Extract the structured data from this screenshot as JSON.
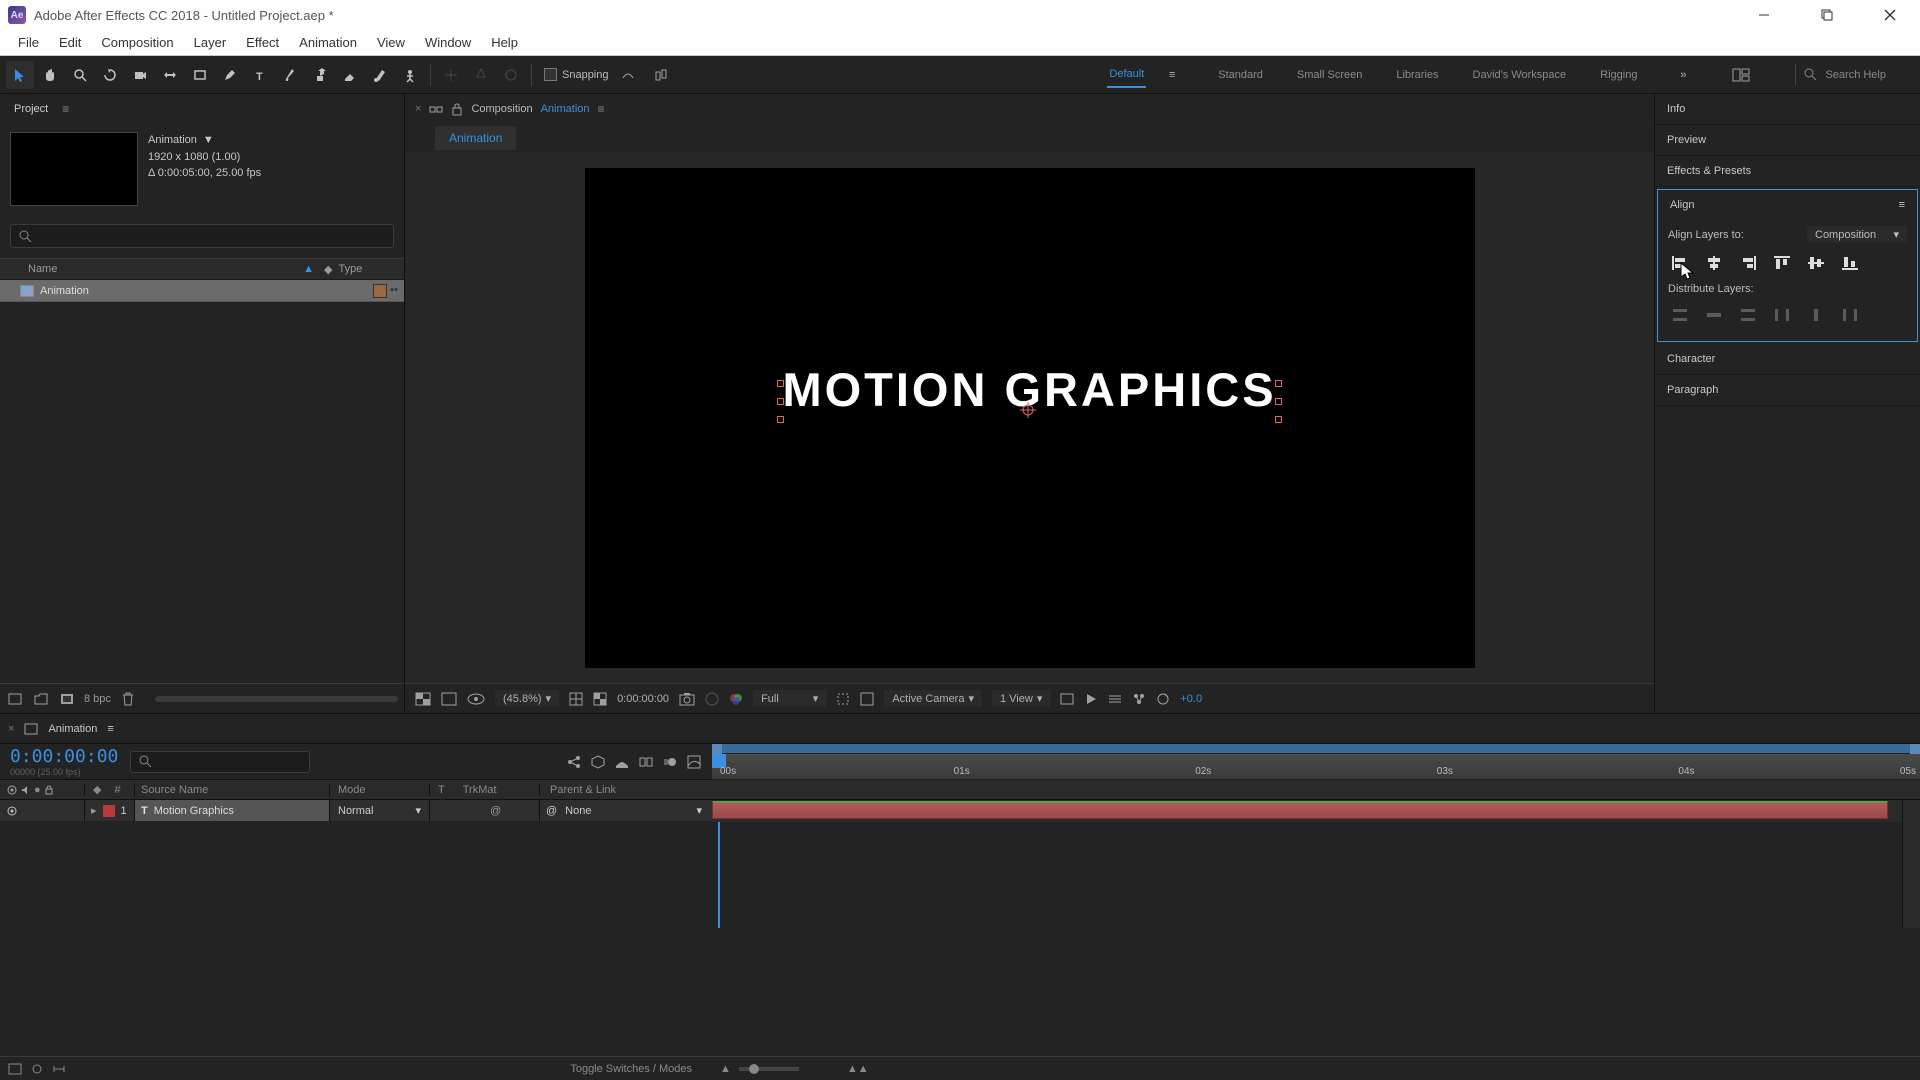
{
  "titlebar": {
    "app_logo_text": "Ae",
    "title": "Adobe After Effects CC 2018 - Untitled Project.aep *"
  },
  "menubar": [
    "File",
    "Edit",
    "Composition",
    "Layer",
    "Effect",
    "Animation",
    "View",
    "Window",
    "Help"
  ],
  "toolbar": {
    "snapping_label": "Snapping",
    "search_placeholder": "Search Help"
  },
  "workspaces": {
    "items": [
      "Default",
      "Standard",
      "Small Screen",
      "Libraries",
      "David's Workspace",
      "Rigging"
    ],
    "active": "Default"
  },
  "project": {
    "tab_label": "Project",
    "selected_name": "Animation",
    "info_dims": "1920 x 1080 (1.00)",
    "info_duration": "Δ 0:00:05:00, 25.00 fps",
    "col_name": "Name",
    "col_type": "Type",
    "items": [
      {
        "name": "Animation"
      }
    ],
    "footer_bpc": "8 bpc"
  },
  "composition": {
    "tab_prefix": "Composition",
    "tab_name": "Animation",
    "breadcrumb": "Animation",
    "text_content": "MOTION GRAPHICS",
    "footer": {
      "zoom": "(45.8%)",
      "timecode": "0:00:00:00",
      "resolution": "Full",
      "camera": "Active Camera",
      "view": "1 View",
      "offset": "+0.0"
    }
  },
  "right_panels": {
    "info": "Info",
    "preview": "Preview",
    "effects_presets": "Effects & Presets",
    "align": {
      "title": "Align",
      "align_to_label": "Align Layers to:",
      "align_to_value": "Composition",
      "distribute_label": "Distribute Layers:"
    },
    "character": "Character",
    "paragraph": "Paragraph"
  },
  "timeline": {
    "tab_name": "Animation",
    "current_time": "0:00:00:00",
    "current_sub": "00000 (25.00 fps)",
    "columns": {
      "num": "#",
      "source": "Source Name",
      "mode": "Mode",
      "t": "T",
      "trkmat": "TrkMat",
      "parent": "Parent & Link"
    },
    "layers": [
      {
        "index": "1",
        "type_glyph": "T",
        "name": "Motion Graphics",
        "mode": "Normal",
        "parent": "None"
      }
    ],
    "ruler_ticks": [
      "00s",
      "01s",
      "02s",
      "03s",
      "04s",
      "05s"
    ],
    "footer_toggle": "Toggle Switches / Modes"
  }
}
